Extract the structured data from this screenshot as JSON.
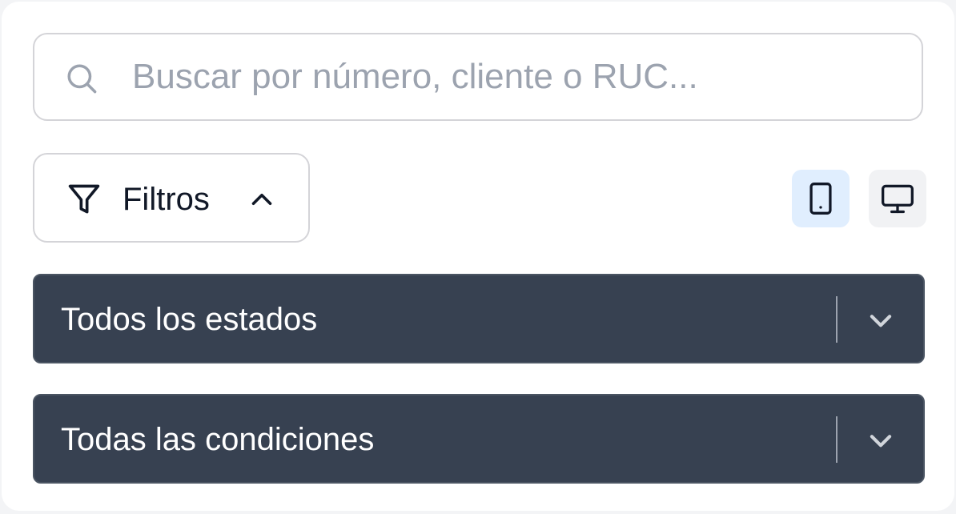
{
  "search": {
    "placeholder": "Buscar por número, cliente o RUC...",
    "value": ""
  },
  "filters": {
    "label": "Filtros",
    "expanded": true
  },
  "view_toggle": {
    "options": [
      "mobile",
      "desktop"
    ],
    "selected": "mobile"
  },
  "selects": {
    "status": {
      "value": "Todos los estados"
    },
    "condition": {
      "value": "Todas las condiciones"
    }
  },
  "colors": {
    "select_bg": "#374151",
    "active_view_bg": "#e0eefe",
    "border": "#d4d4d8"
  },
  "icons": [
    "search-icon",
    "filter-icon",
    "chevron-up-icon",
    "tablet-icon",
    "monitor-icon",
    "chevron-down-icon"
  ]
}
